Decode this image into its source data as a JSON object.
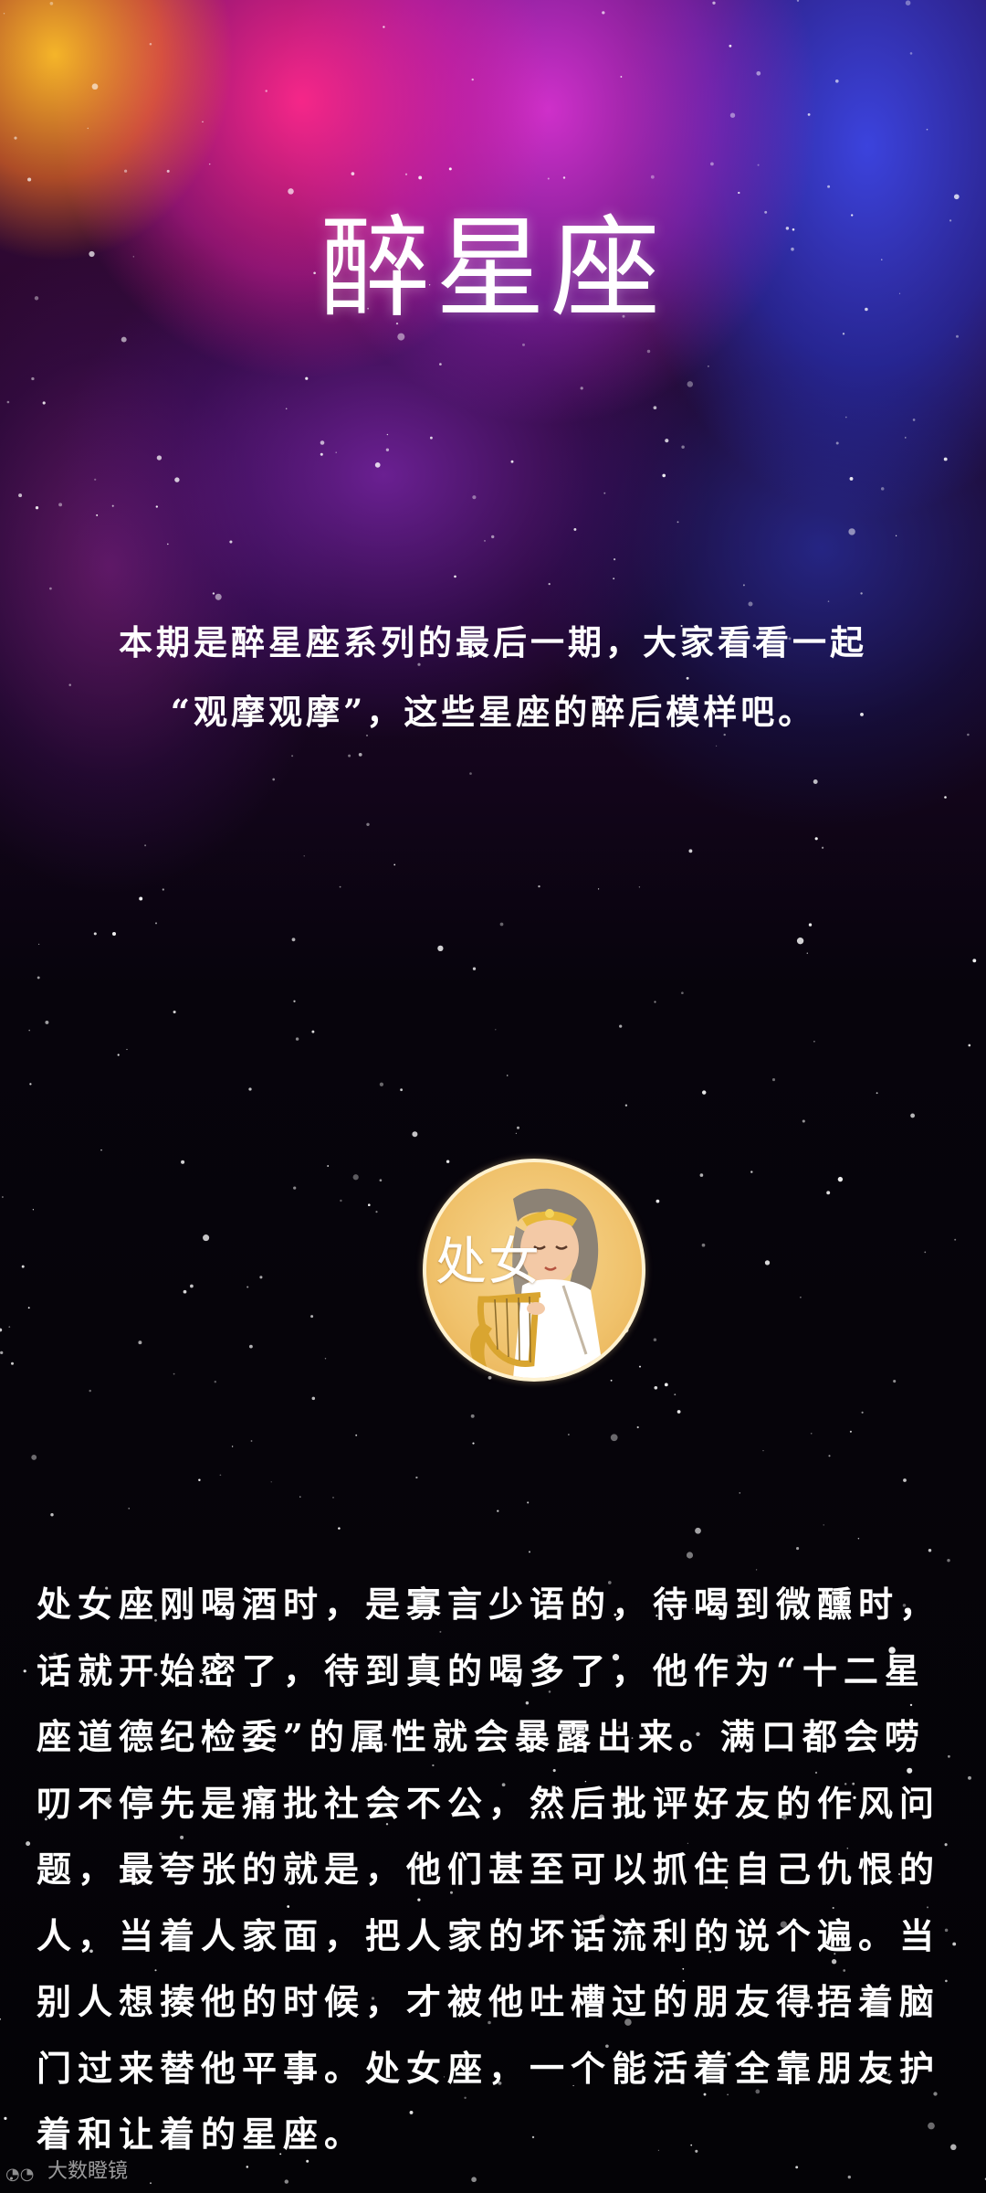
{
  "header": {
    "title": "醉星座"
  },
  "intro": {
    "lines": [
      "本期是醉星座系列的最后一期，大家看看一起",
      "“观摩观摩”，这些星座的醉后模样吧。"
    ]
  },
  "badge": {
    "label": "处女",
    "icon": "virgo-harp-illustration-icon"
  },
  "article": {
    "paragraph": "处女座刚喝酒时，是寡言少语的，待喝到微醺时，话就开始密了，待到真的喝多了，他作为“十二星座道德纪检委”的属性就会暴露出来。满口都会唠叨不停先是痛批社会不公，然后批评好友的作风问题，最夸张的就是，他们甚至可以抓住自己仇恨的人，当着人家面，把人家的坏话流利的说个遍。当别人想揍他的时候，才被他吐槽过的朋友得捂着脑门过来替他平事。处女座，一个能活着全靠朋友护着和让着的星座。"
  },
  "watermark": {
    "text": "大数瞪镜",
    "icon": "watermark-logo-icon"
  },
  "colors": {
    "text": "#ffffff",
    "badge_fill": "#f0c26c",
    "background": "#050307"
  }
}
